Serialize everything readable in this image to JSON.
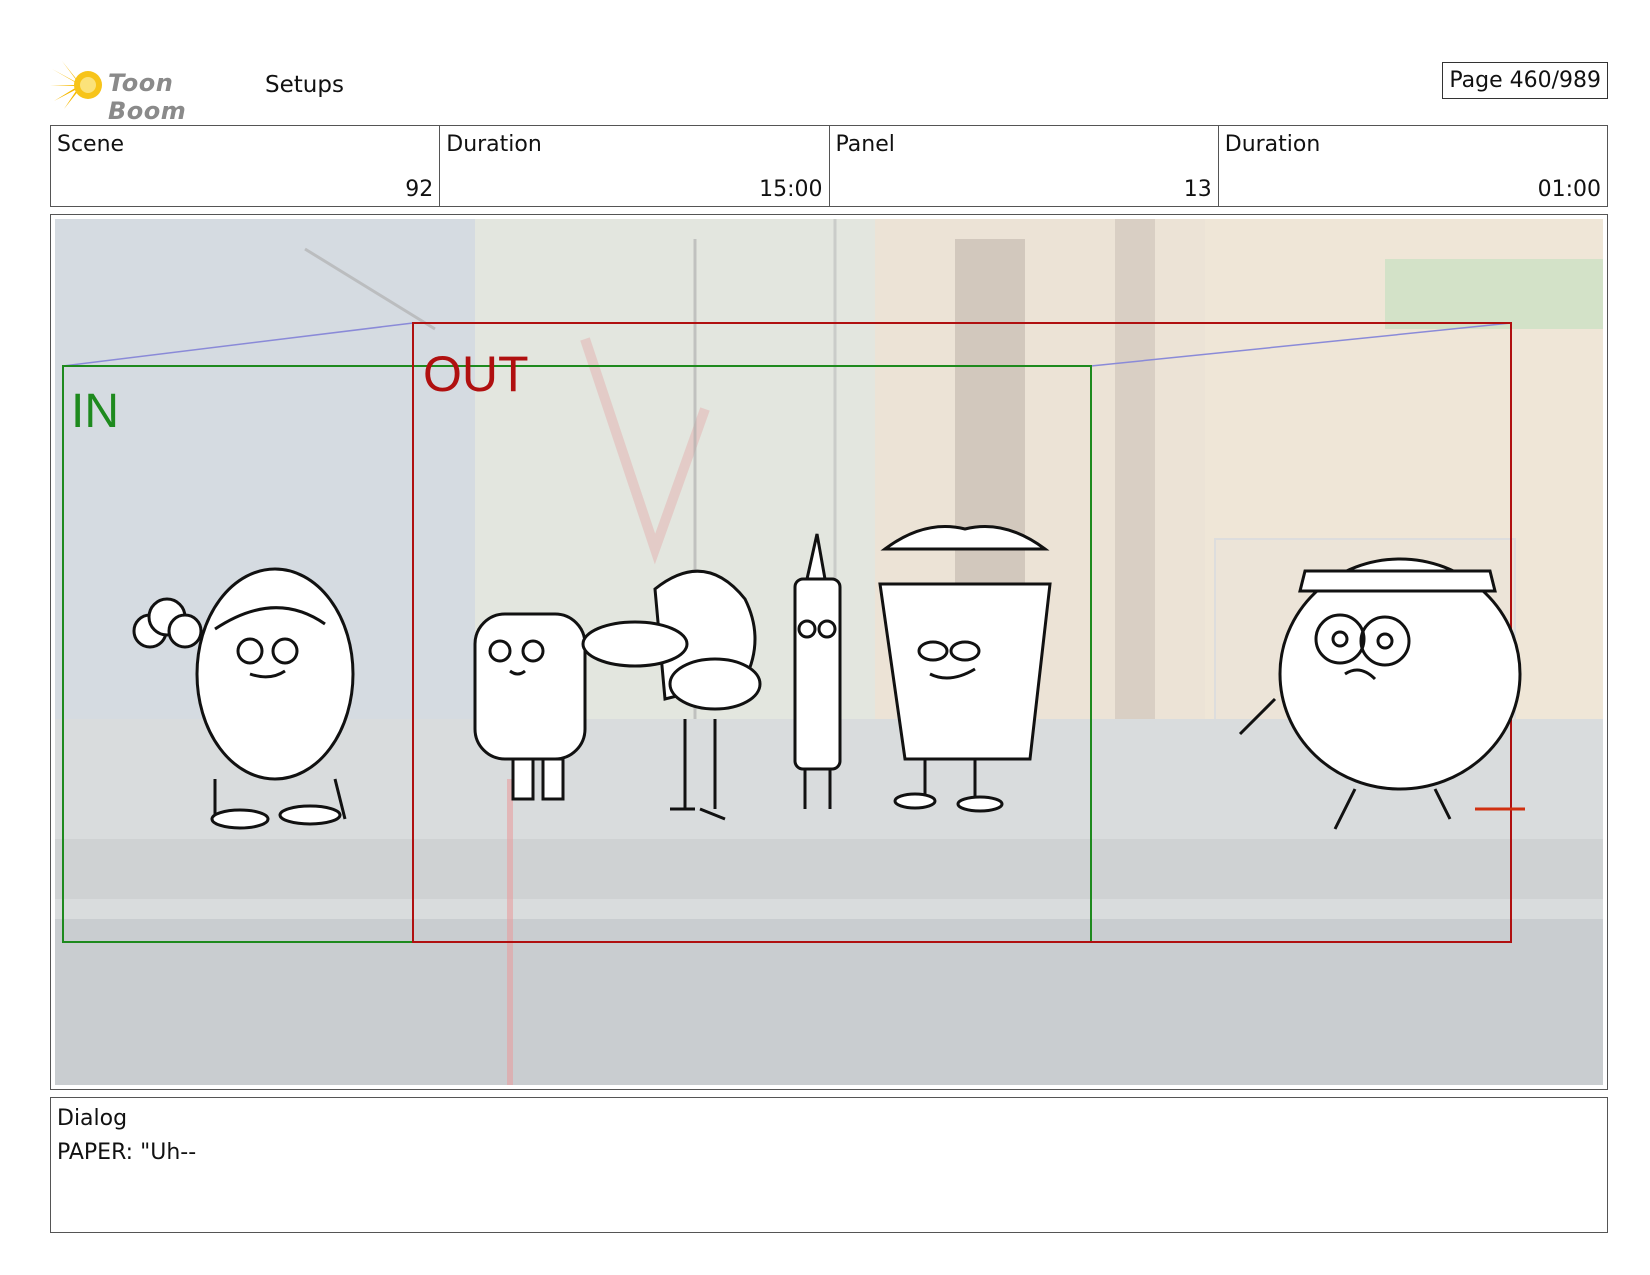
{
  "header": {
    "logo_text": "Toon Boom",
    "section": "Setups",
    "page": "Page 460/989"
  },
  "info": [
    {
      "label": "Scene",
      "value": "92"
    },
    {
      "label": "Duration",
      "value": "15:00"
    },
    {
      "label": "Panel",
      "value": "13"
    },
    {
      "label": "Duration",
      "value": "01:00"
    }
  ],
  "panel": {
    "in_label": "IN",
    "out_label": "OUT",
    "in_color": "#1e8a1e",
    "out_color": "#b01010"
  },
  "dialog": {
    "label": "Dialog",
    "text": "PAPER: \"Uh--"
  }
}
